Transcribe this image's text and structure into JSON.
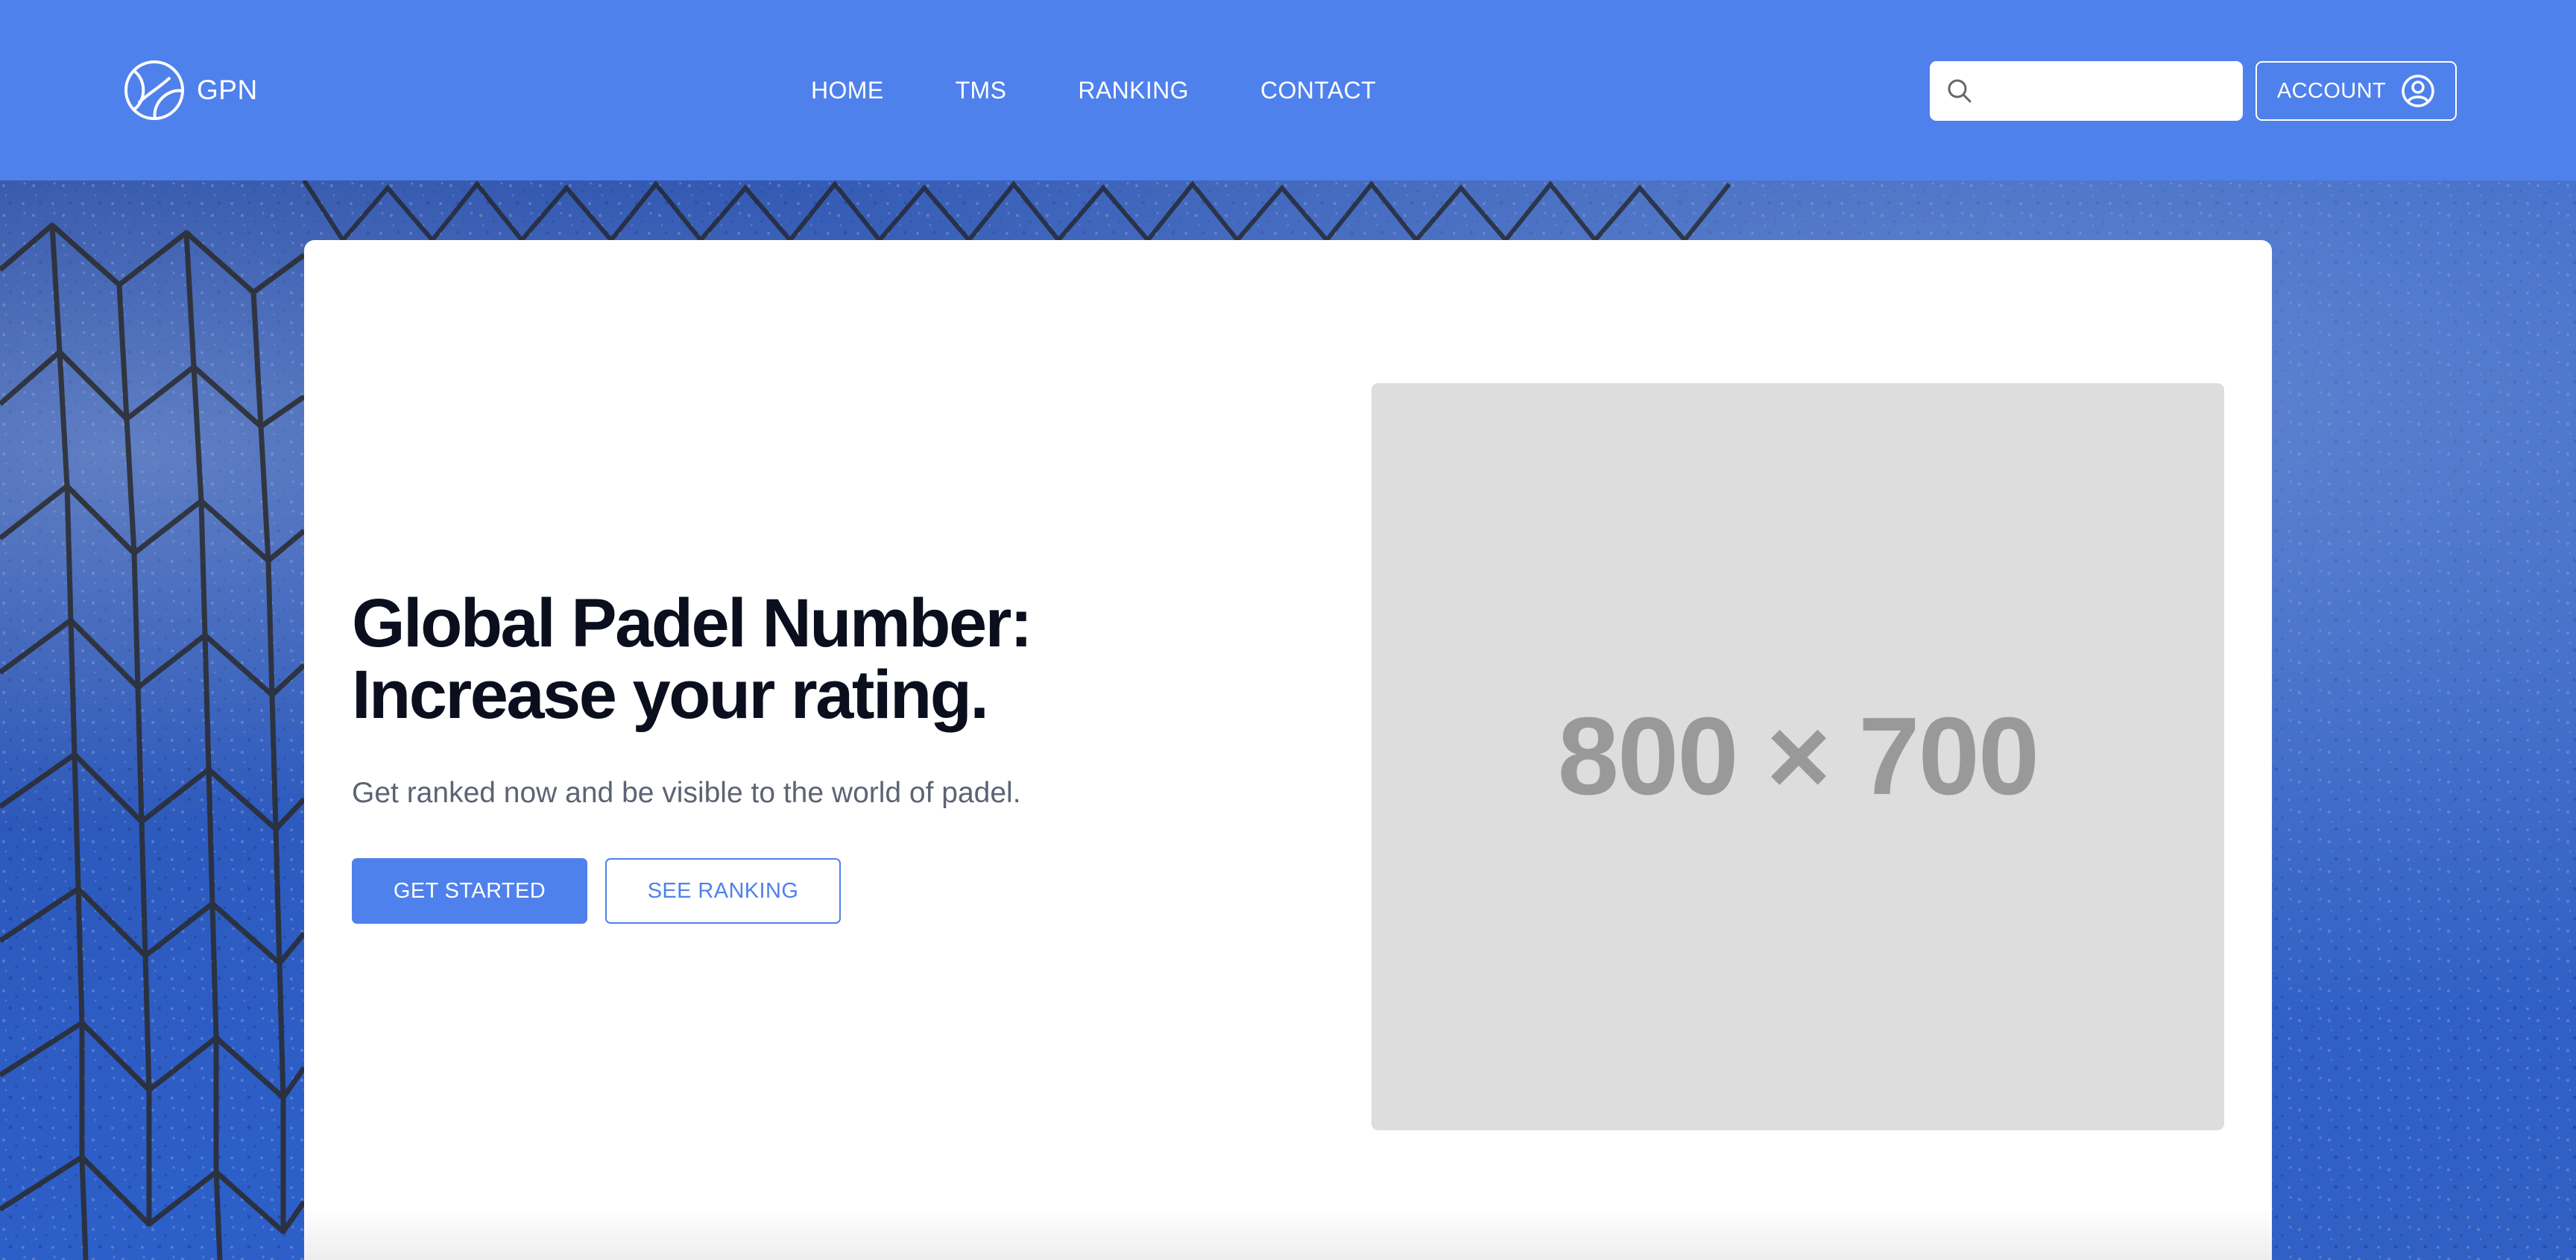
{
  "colors": {
    "brand": "#4f81ec",
    "heading": "#0b0f1d",
    "muted": "#5c6474",
    "placeholder_bg": "#dddddd",
    "placeholder_text": "#999999"
  },
  "header": {
    "logo_icon": "tennis-ball-icon",
    "brand_name": "GPN",
    "nav": [
      {
        "label": "HOME"
      },
      {
        "label": "TMS"
      },
      {
        "label": "RANKING"
      },
      {
        "label": "CONTACT"
      }
    ],
    "search": {
      "icon": "search-icon",
      "value": "",
      "placeholder": ""
    },
    "account": {
      "label": "ACCOUNT",
      "icon": "user-circle-icon"
    }
  },
  "hero": {
    "background": "padel-court-net-photo",
    "headline_line1": "Global Padel Number:",
    "headline_line2": "Increase your rating.",
    "subtitle": "Get ranked now and be visible to the world of padel.",
    "primary_button": "GET STARTED",
    "secondary_button": "SEE RANKING",
    "image_placeholder": "800 × 700"
  }
}
